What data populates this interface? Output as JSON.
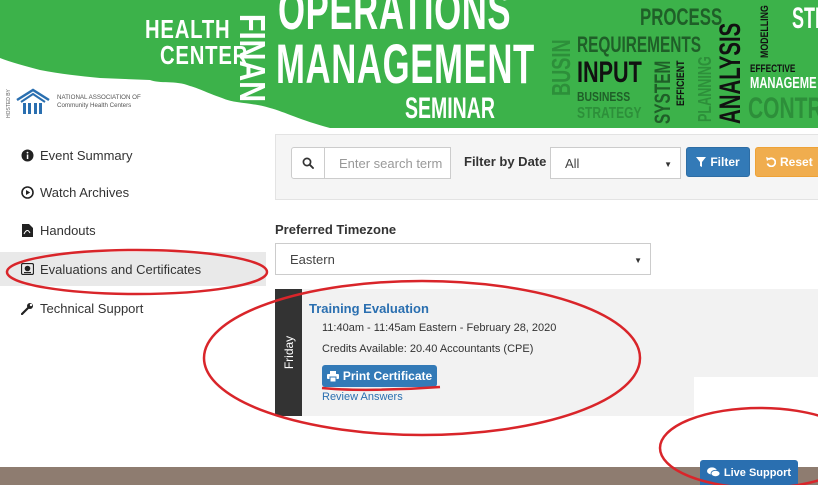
{
  "banner": {
    "health": "HEALTH",
    "center": "CENTER",
    "finan": "FINAN",
    "operations": "OPERATIONS",
    "management": "MANAGEMENT",
    "seminar": "SEMINAR",
    "org_line1": "NATIONAL ASSOCIATION OF",
    "org_line2": "Community Health Centers",
    "hosted_by": "HOSTED BY",
    "word_cloud": {
      "busin": "BUSIN",
      "process": "PROCESS",
      "requirements": "REQUIREMENTS",
      "input": "INPUT",
      "business": "BUSINESS",
      "strategy": "STRATEGY",
      "system": "SYSTEM",
      "efficient": "EFFICIENT",
      "planning": "PLANNING",
      "analysis": "ANALYSIS",
      "modelling": "MODELLING",
      "effective": "EFFECTIVE",
      "manage": "MANAGEME",
      "contr": "CONTR",
      "strat": "STRAT"
    }
  },
  "sidebar": {
    "items": [
      {
        "label": "Event Summary",
        "icon": "info-circle-icon"
      },
      {
        "label": "Watch Archives",
        "icon": "play-circle-icon"
      },
      {
        "label": "Handouts",
        "icon": "file-pdf-icon"
      },
      {
        "label": "Evaluations and Certificates",
        "icon": "certificate-icon",
        "active": true
      },
      {
        "label": "Technical Support",
        "icon": "wrench-icon"
      }
    ]
  },
  "search": {
    "placeholder": "Enter search term",
    "filter_label": "Filter by Date",
    "filter_value": "All",
    "filter_button": "Filter",
    "reset_button": "Reset"
  },
  "timezone": {
    "label": "Preferred Timezone",
    "value": "Eastern"
  },
  "event": {
    "day": "Friday",
    "title": "Training Evaluation",
    "time": "11:40am - 11:45am Eastern - February 28, 2020",
    "credits": "Credits Available: 20.40 Accountants (CPE)",
    "print_button": "Print Certificate",
    "review_link": "Review Answers"
  },
  "footer": {
    "live_support": "Live Support"
  },
  "colors": {
    "banner_green": "#3cb24a",
    "primary_blue": "#337ab7",
    "warning_orange": "#f0ad4e",
    "annotation_red": "#d9252a",
    "footer_brown": "#8e7c70"
  }
}
